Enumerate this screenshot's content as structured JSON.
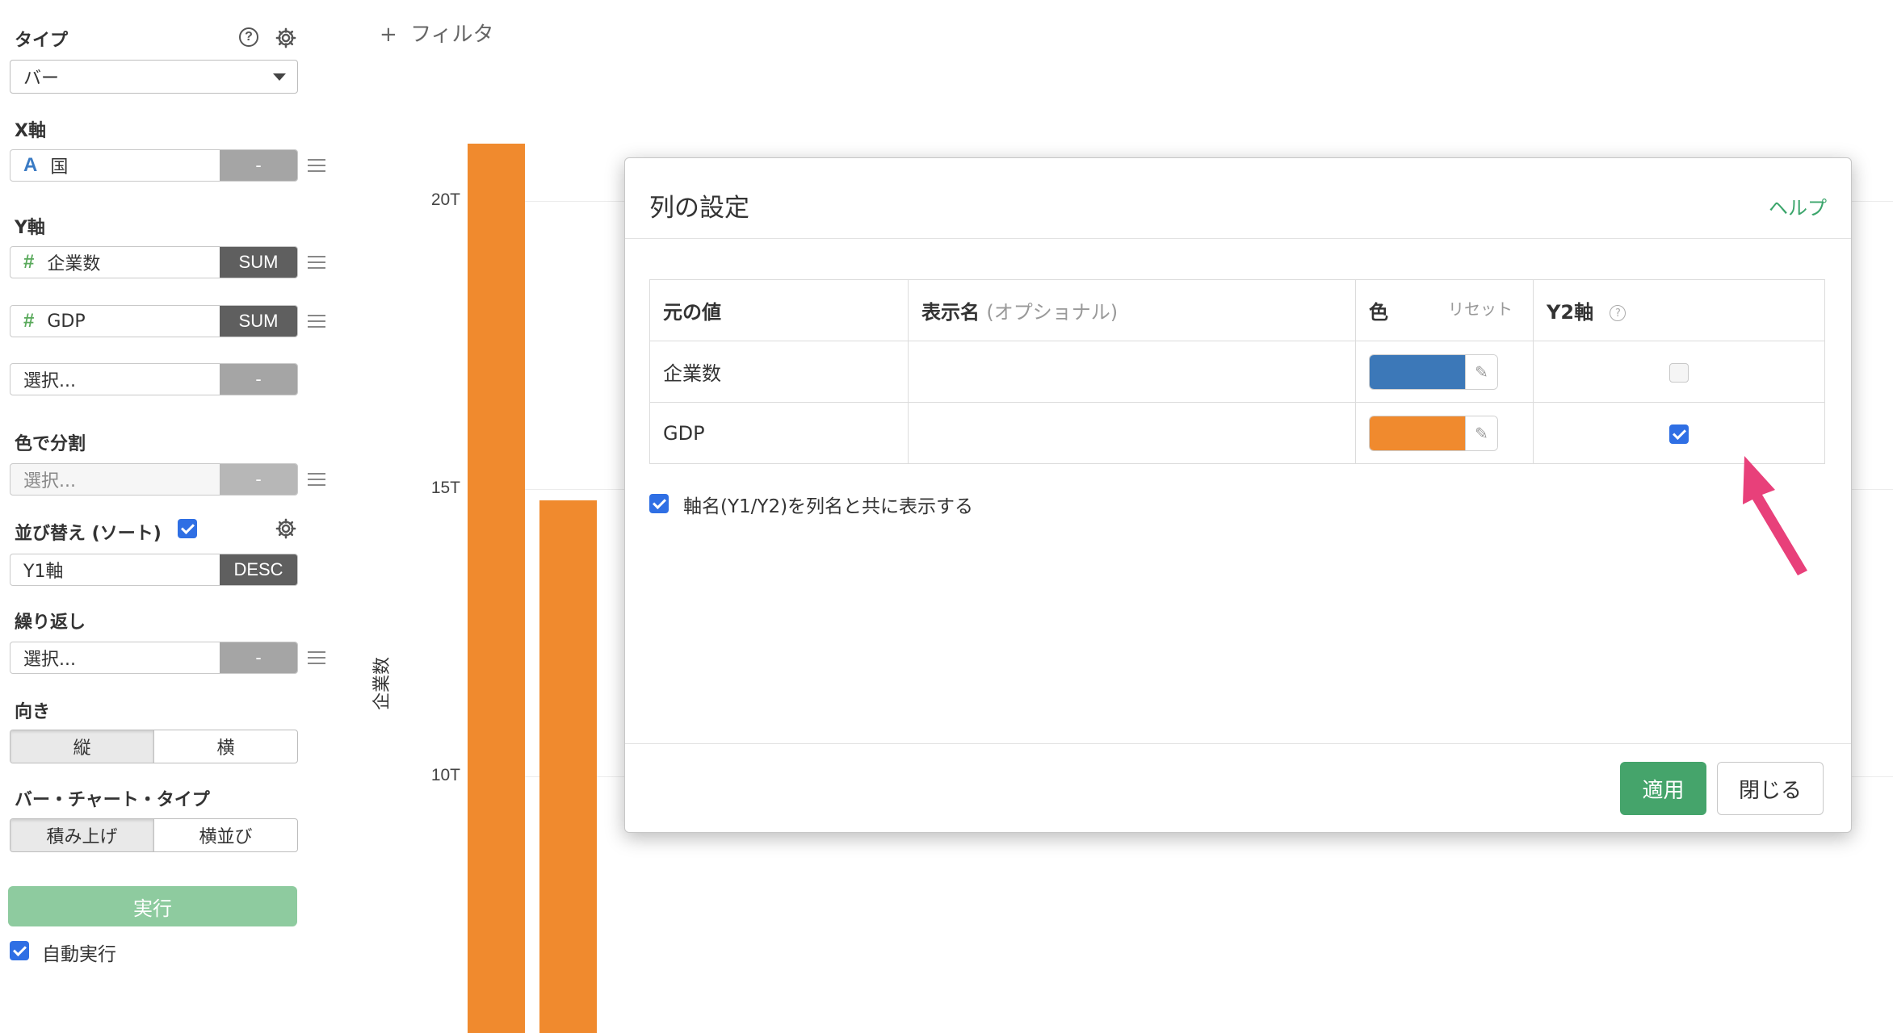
{
  "sidebar": {
    "type_label": "タイプ",
    "type_value": "バー",
    "x_axis_label": "X軸",
    "x_field": {
      "icon": "A",
      "name": "国",
      "agg": "-"
    },
    "y_axis_label": "Y軸",
    "y_fields": [
      {
        "icon": "#",
        "name": "企業数",
        "agg": "SUM"
      },
      {
        "icon": "#",
        "name": "GDP",
        "agg": "SUM"
      }
    ],
    "y_select_placeholder": "選択...",
    "y_select_agg": "-",
    "color_split_label": "色で分割",
    "color_split_placeholder": "選択...",
    "color_split_agg": "-",
    "sort_label": "並び替え (ソート)",
    "sort_field": "Y1軸",
    "sort_order": "DESC",
    "repeat_label": "繰り返し",
    "repeat_placeholder": "選択...",
    "repeat_agg": "-",
    "direction_label": "向き",
    "direction_options": [
      "縦",
      "横"
    ],
    "bar_type_label": "バー・チャート・タイプ",
    "bar_type_options": [
      "積み上げ",
      "横並び"
    ],
    "run_label": "実行",
    "auto_run_label": "自動実行"
  },
  "toolbar": {
    "filter_label": "フィルタ",
    "plus": "+"
  },
  "chart_data": {
    "type": "bar",
    "ylabel": "企業数",
    "yticks": [
      "20T",
      "15T",
      "10T"
    ],
    "values_trillions": [
      21,
      14.8
    ],
    "color": "#f08a2e"
  },
  "modal": {
    "title": "列の設定",
    "help_label": "ヘルプ",
    "headers": {
      "original": "元の値",
      "display": "表示名",
      "display_hint": "(オプショナル)",
      "color": "色",
      "reset": "リセット",
      "y2": "Y2軸",
      "y2_help": "?"
    },
    "rows": [
      {
        "name": "企業数",
        "display": "",
        "color": "#3c78b8",
        "y2": false
      },
      {
        "name": "GDP",
        "display": "",
        "color": "#f08a2e",
        "y2": true
      }
    ],
    "show_axis_name_label": "軸名(Y1/Y2)を列名と共に表示する",
    "apply_label": "適用",
    "close_label": "閉じる"
  },
  "annotation_color": "#e8407a"
}
